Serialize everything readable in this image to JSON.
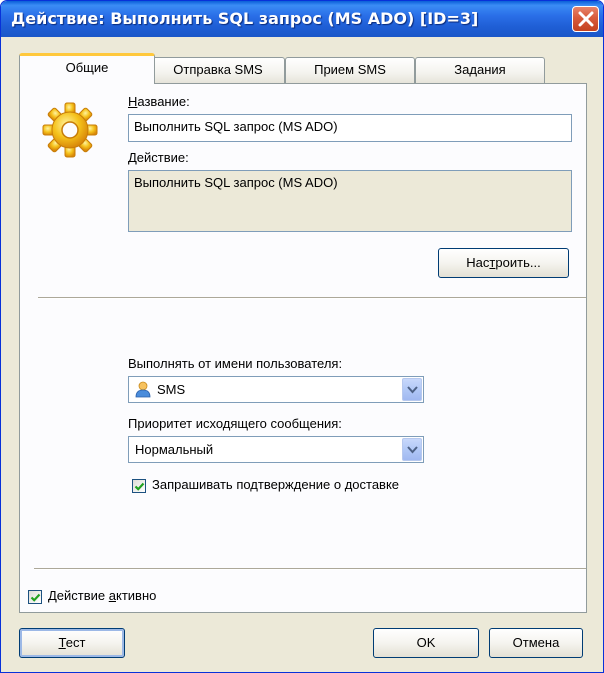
{
  "window": {
    "title": "Действие: Выполнить SQL запрос (MS ADO) [ID=3]",
    "close_icon": "close-icon"
  },
  "tabs": [
    {
      "label": "Общие",
      "active": true
    },
    {
      "label": "Отправка SMS",
      "active": false
    },
    {
      "label": "Прием SMS",
      "active": false
    },
    {
      "label": "Задания",
      "active": false
    }
  ],
  "general": {
    "icon": "gear-icon",
    "name_label_hotkey": "Н",
    "name_label_rest": "азвание:",
    "name_value": "Выполнить SQL запрос (MS ADO)",
    "action_label": "Действие:",
    "action_value": "Выполнить SQL запрос (MS ADO)",
    "configure_pre": "Нас",
    "configure_hotkey": "т",
    "configure_post": "роить...",
    "run_as_label": "Выполнять от имени пользователя:",
    "run_as_value": "SMS",
    "run_as_icon": "user-icon",
    "priority_label": "Приоритет исходящего сообщения:",
    "priority_value": "Нормальный",
    "delivery_confirm_label": "Запрашивать подтверждение о доставке",
    "delivery_confirm_checked": true
  },
  "footer": {
    "active_pre": "Действие ",
    "active_hotkey": "а",
    "active_post": "ктивно",
    "active_checked": true,
    "test_hotkey": "Т",
    "test_rest": "ест",
    "ok_label": "OK",
    "cancel_label": "Отмена"
  },
  "colors": {
    "titlebar": "#2a6fe8",
    "dialog_bg": "#ece9d8",
    "tab_highlight": "#ffc83c",
    "close_button": "#d85b3c"
  }
}
